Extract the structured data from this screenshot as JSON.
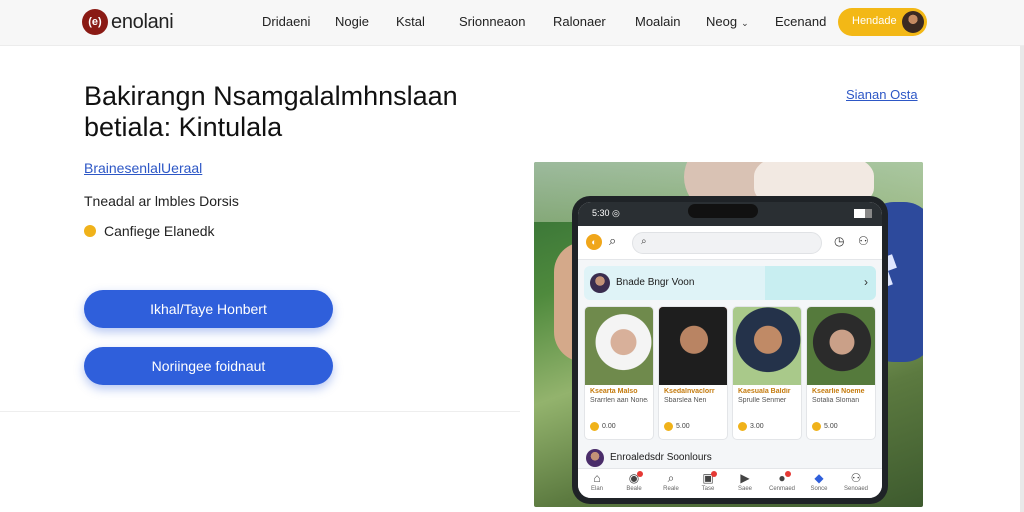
{
  "brand": {
    "logo_mark": "(e)",
    "name": "enolani"
  },
  "nav": {
    "items": [
      "Dridaeni",
      "Nogie",
      "Kstal",
      "Srionneaon",
      "Ralonaer",
      "Moalain",
      "Neog",
      "Ecenand"
    ],
    "cta_label": "Hendade"
  },
  "hero": {
    "headline": "Bakirangn Nsamgalalmhnslaan betiala: Kintulala",
    "side_link": "Sianan Osta",
    "inline_link": "BrainesenlalUeraal",
    "info_line": "Tneadal ar lmbles Dorsis",
    "info_badge_text": "Canfiege Elanedk",
    "primary_button": "Ikhal/Taye Honbert",
    "secondary_button": "Noriingee foidnaut"
  },
  "phone": {
    "status_time": "5:30 ◎",
    "feature_title": "Bnade Bngr Voon",
    "profiles": [
      {
        "name": "Ksearta Malso",
        "meta": "Srarrlen aan Nonea",
        "rating": "0.00"
      },
      {
        "name": "Ksedalnvaclorr",
        "meta": "Sbarslea Nen",
        "rating": "5.00"
      },
      {
        "name": "Kaesuala Baldir",
        "meta": "Sprulle Senmer",
        "rating": "3.00"
      },
      {
        "name": "Ksearlie Noeme",
        "meta": "Sotalia Sloman",
        "rating": "5.00"
      }
    ],
    "channel_title": "Enroaledsdr Soonlours",
    "bottom_nav": [
      {
        "icon": "home-icon",
        "glyph": "⌂",
        "label": "Elan"
      },
      {
        "icon": "orders-icon",
        "glyph": "◉",
        "label": "Beale"
      },
      {
        "icon": "search-icon",
        "glyph": "⌕",
        "label": "Reale"
      },
      {
        "icon": "messages-icon",
        "glyph": "▣",
        "label": "Tase"
      },
      {
        "icon": "video-icon",
        "glyph": "▶",
        "label": "Saee"
      },
      {
        "icon": "alerts-icon",
        "glyph": "●",
        "label": "Cenmaed"
      },
      {
        "icon": "share-icon",
        "glyph": "◆",
        "label": "Sonce"
      },
      {
        "icon": "profile-icon",
        "glyph": "⚇",
        "label": "Senoaed"
      }
    ]
  },
  "colors": {
    "accent_blue": "#2f5fdb",
    "accent_yellow": "#f3b816",
    "logo_red": "#8a1a14",
    "link_blue": "#2d57c6"
  }
}
